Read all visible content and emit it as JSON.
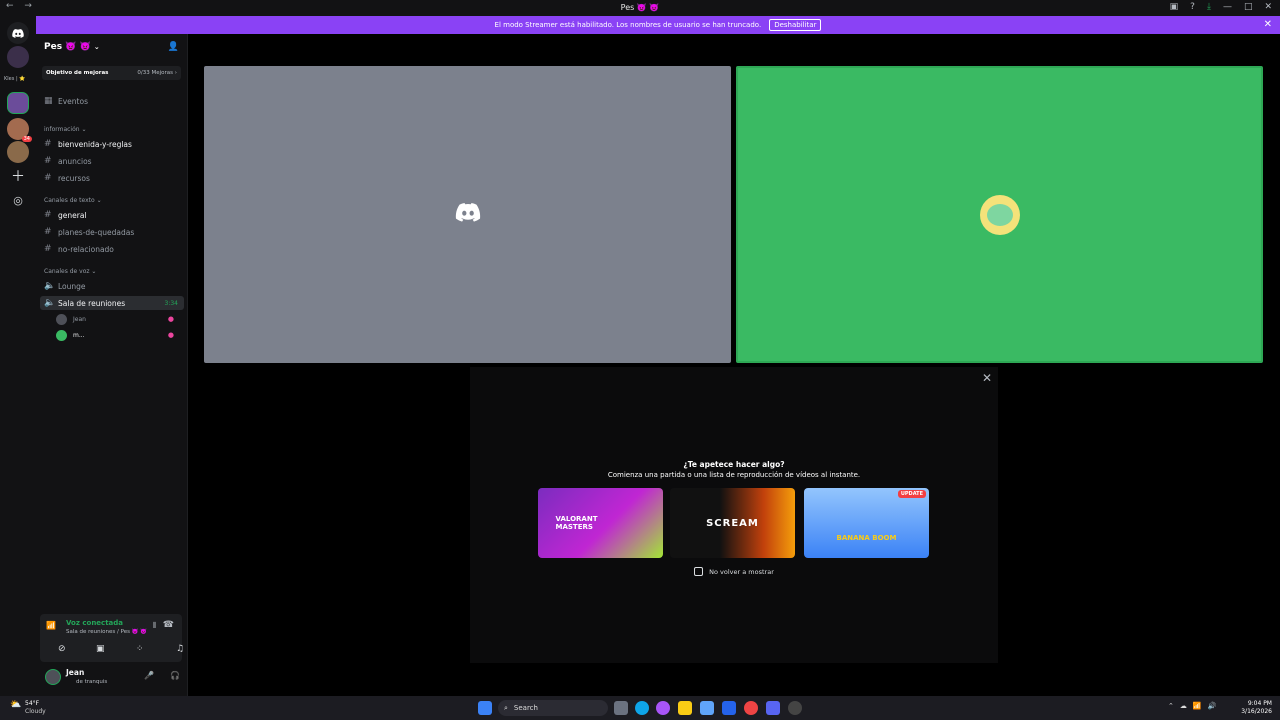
{
  "window": {
    "title": "Pes 👿 👿"
  },
  "banner": {
    "text": "El modo Streamer está habilitado. Los nombres de usuario se han truncado.",
    "button": "Deshabilitar"
  },
  "rail": {
    "label": "Kles | ⭐",
    "badge": "34"
  },
  "server": {
    "name": "Pes 👿 👿",
    "boost_label": "Objetivo de mejoras",
    "boost_value": "0/33 Mejoras ›",
    "events": "Eventos",
    "categories": [
      {
        "name": "información ⌄",
        "channels": [
          "bienvenida-y-reglas",
          "anuncios",
          "recursos"
        ]
      },
      {
        "name": "Canales de texto ⌄",
        "channels": [
          "general",
          "planes-de-quedadas",
          "no-relacionado"
        ]
      },
      {
        "name": "Canales de voz ⌄",
        "channels": [
          "Lounge",
          "Sala de reuniones"
        ]
      }
    ],
    "voice_timer": "3:34",
    "voice_members": [
      "Jean",
      "m..."
    ]
  },
  "voice_panel": {
    "status": "Voz conectada",
    "location": "Sala de reuniones / Pes 👿 👿"
  },
  "user": {
    "name": "Jean",
    "status": "de tranquis"
  },
  "activity": {
    "title": "¿Te apetece hacer algo?",
    "subtitle": "Comienza una partida o una lista de reproducción de vídeos al instante.",
    "games": [
      {
        "name": "VALORANT MASTERS"
      },
      {
        "name": "SCREAM"
      },
      {
        "name": "BANANA BOOM",
        "badge": "UPDATE"
      }
    ],
    "checkbox_label": "No volver a mostrar"
  },
  "taskbar": {
    "weather_temp": "54°F",
    "weather_desc": "Cloudy",
    "search": "Search",
    "time": "9:04 PM",
    "date": "3/16/2026"
  },
  "colors": {
    "accent": "#8a42f5",
    "tile_gray": "#7c818d",
    "tile_green": "#3aba63",
    "voice_green": "#23a559"
  }
}
